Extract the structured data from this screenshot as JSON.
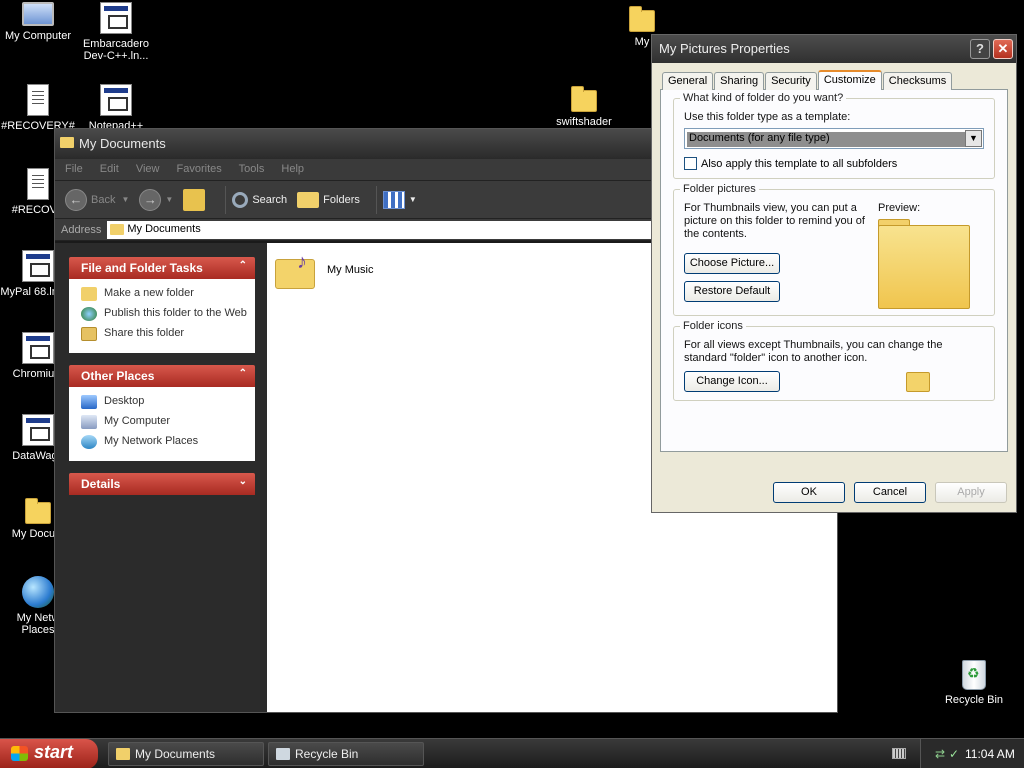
{
  "desktop": {
    "icons": [
      {
        "label": "My Computer",
        "icon": "computer-icon"
      },
      {
        "label": "Embarcadero Dev-C++.ln...",
        "icon": "app-shortcut-icon"
      },
      {
        "label": "#RECOVERY#",
        "icon": "text-file-icon"
      },
      {
        "label": "Notepad++",
        "icon": "app-shortcut-icon"
      },
      {
        "label": "swiftshader",
        "icon": "folder-icon"
      },
      {
        "label": "#RECOVE",
        "icon": "text-file-icon"
      },
      {
        "label": "MyPal 68.lnk.cr",
        "icon": "app-shortcut-icon"
      },
      {
        "label": "Chromium",
        "icon": "app-shortcut-icon"
      },
      {
        "label": "DataWago",
        "icon": "app-shortcut-icon"
      },
      {
        "label": "My Docum",
        "icon": "documents-folder-icon"
      },
      {
        "label": "My Netw Places",
        "icon": "network-icon"
      },
      {
        "label": "My",
        "icon": "folder-icon"
      },
      {
        "label": "Recycle Bin",
        "icon": "recycle-bin-icon"
      }
    ]
  },
  "explorer": {
    "title": "My Documents",
    "menu": [
      "File",
      "Edit",
      "View",
      "Favorites",
      "Tools",
      "Help"
    ],
    "toolbar": {
      "back": "Back",
      "search": "Search",
      "folders": "Folders"
    },
    "address": {
      "label": "Address",
      "value": "My Documents"
    },
    "tasks": {
      "title": "File and Folder Tasks",
      "items": [
        "Make a new folder",
        "Publish this folder to the Web",
        "Share this folder"
      ]
    },
    "other_places": {
      "title": "Other Places",
      "items": [
        "Desktop",
        "My Computer",
        "My Network Places"
      ]
    },
    "details": {
      "title": "Details"
    },
    "files": [
      {
        "name": "My Music",
        "icon": "music-folder-icon"
      }
    ]
  },
  "dialog": {
    "title": "My Pictures Properties",
    "tabs": [
      "General",
      "Sharing",
      "Security",
      "Customize",
      "Checksums"
    ],
    "active_tab": "Customize",
    "folder_type": {
      "group_title": "What kind of folder do you want?",
      "template_label": "Use this folder type as a template:",
      "selected": "Documents (for any file type)",
      "apply_subfolders": "Also apply this template to all subfolders"
    },
    "folder_pictures": {
      "group_title": "Folder pictures",
      "description": "For Thumbnails view, you can put a picture on this folder to remind you of the contents.",
      "preview_label": "Preview:",
      "choose_button": "Choose Picture...",
      "restore_button": "Restore Default"
    },
    "folder_icons": {
      "group_title": "Folder icons",
      "description": "For all views except Thumbnails, you can change the standard \"folder\" icon to another icon.",
      "change_button": "Change Icon..."
    },
    "buttons": {
      "ok": "OK",
      "cancel": "Cancel",
      "apply": "Apply"
    }
  },
  "taskbar": {
    "start": "start",
    "tasks": [
      "My Documents",
      "Recycle Bin"
    ],
    "clock": "11:04 AM"
  }
}
